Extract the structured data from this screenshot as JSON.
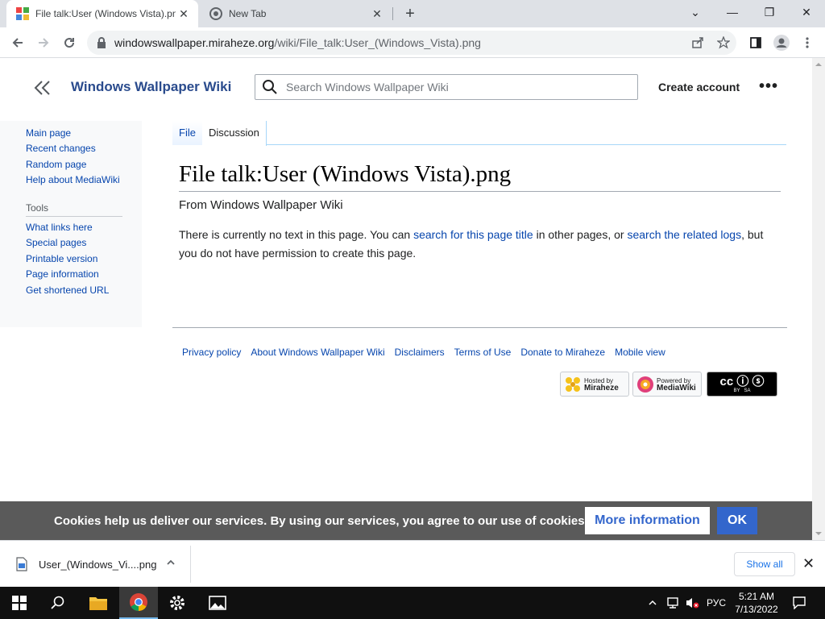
{
  "browser": {
    "tabs": [
      {
        "title": "File talk:User (Windows Vista).png",
        "close": "✕"
      },
      {
        "title": "New Tab",
        "close": "✕"
      }
    ],
    "new_tab": "+",
    "window_controls": {
      "tab_search": "⌄",
      "minimize": "—",
      "restore": "❐",
      "close": "✕"
    },
    "url": {
      "domain": "windowswallpaper.miraheze.org",
      "path": "/wiki/File_talk:User_(Windows_Vista).png"
    }
  },
  "header": {
    "site_title": "Windows Wallpaper Wiki",
    "search_placeholder": "Search Windows Wallpaper Wiki",
    "create_account": "Create account",
    "more": "•••"
  },
  "sidebar": {
    "navigation": [
      "Main page",
      "Recent changes",
      "Random page",
      "Help about MediaWiki"
    ],
    "tools_heading": "Tools",
    "tools": [
      "What links here",
      "Special pages",
      "Printable version",
      "Page information",
      "Get shortened URL"
    ]
  },
  "page_tabs": {
    "file": "File",
    "discussion": "Discussion"
  },
  "content": {
    "heading": "File talk:User (Windows Vista).png",
    "subtitle": "From Windows Wallpaper Wiki",
    "body_1": "There is currently no text in this page. You can ",
    "link_1": "search for this page title",
    "body_2": " in other pages, or ",
    "link_2": "search the related logs",
    "body_3": ", but you do not have permission to create this page."
  },
  "footer": {
    "links": [
      "Privacy policy",
      "About Windows Wallpaper Wiki",
      "Disclaimers",
      "Terms of Use",
      "Donate to Miraheze",
      "Mobile view"
    ],
    "badges": {
      "miraheze": {
        "line1": "Hosted by",
        "line2": "Miraheze"
      },
      "mediawiki": {
        "line1": "Powered by",
        "line2": "MediaWiki"
      },
      "cc": {
        "main": "cc ⓘ ⓢ",
        "sub": "BY   SA"
      }
    }
  },
  "cookie": {
    "text": "Cookies help us deliver our services. By using our services, you agree to our use of cookies.",
    "more_info": "More information",
    "ok": "OK"
  },
  "downloads": {
    "file": "User_(Windows_Vi....png",
    "show_all": "Show all",
    "close": "✕"
  },
  "taskbar": {
    "lang": "РУС",
    "time": "5:21 AM",
    "date": "7/13/2022"
  },
  "colors": {
    "link": "#0645ad",
    "site_title": "#2a4b8d",
    "cookie_bg": "#5a5a5a",
    "ok_button": "#36c",
    "chrome_tab_strip": "#dee1e6"
  }
}
